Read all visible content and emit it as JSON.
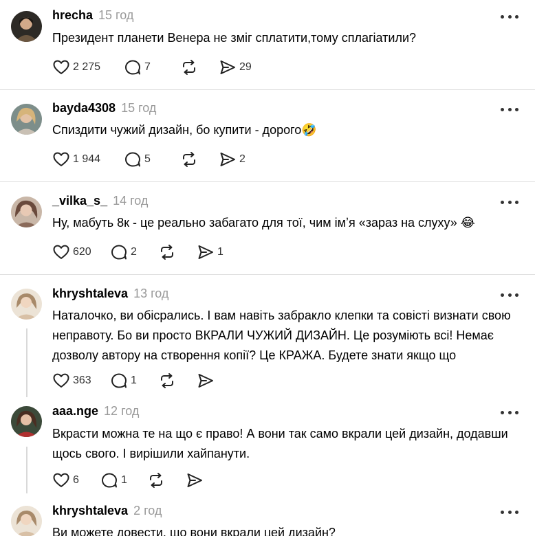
{
  "posts": [
    {
      "username": "hrecha",
      "time": "15 год",
      "text": "Президент планети Венера не зміг сплатити,тому сплагіатили?",
      "likes": "2 275",
      "replies": "7",
      "reposts": "",
      "shares": "29",
      "avatar_color": "#6b5640"
    },
    {
      "username": "bayda4308",
      "time": "15 год",
      "text": "Спиздити чужий дизайн, бо купити - дорого🤣",
      "likes": "1 944",
      "replies": "5",
      "reposts": "",
      "shares": "2",
      "avatar_color": "#b8a27a"
    },
    {
      "username": "_vilka_s_",
      "time": "14 год",
      "text": "Ну, мабуть 8к - це реально забагато для тої, чим імʼя «зараз на слуху» 😂",
      "likes": "620",
      "replies": "2",
      "reposts": "",
      "shares": "1",
      "avatar_color": "#8a6a5a"
    },
    {
      "username": "khryshtaleva",
      "time": "13 год",
      "text": "Наталочко, ви обісрались. І вам навіть забракло клепки та совісті визнати свою неправоту. Бо ви просто ВКРАЛИ ЧУЖИЙ ДИЗАЙН. Це розуміють всі! Немає дозволу автору на створення копії? Це КРАЖА. Будете знати якщо що",
      "likes": "363",
      "replies": "1",
      "reposts": "",
      "shares": "",
      "avatar_color": "#d8c0a6"
    },
    {
      "username": "aaa.nge",
      "time": "12 год",
      "text": "Вкрасти можна те на що є право! А вони так само вкрали цей дизайн, додавши щось свого. І вирішили хайпанути.",
      "likes": "6",
      "replies": "1",
      "reposts": "",
      "shares": "",
      "avatar_color": "#6b4a3a"
    },
    {
      "username": "khryshtaleva",
      "time": "2 год",
      "text": "Ви можете довести, що вони вкрали цей дизайн?",
      "likes": "",
      "replies": "",
      "reposts": "",
      "shares": "",
      "avatar_color": "#d8c0a6"
    }
  ],
  "icons": {
    "like": "heart-icon",
    "reply": "comment-icon",
    "repost": "repost-icon",
    "share": "share-icon",
    "more": "more-icon"
  }
}
